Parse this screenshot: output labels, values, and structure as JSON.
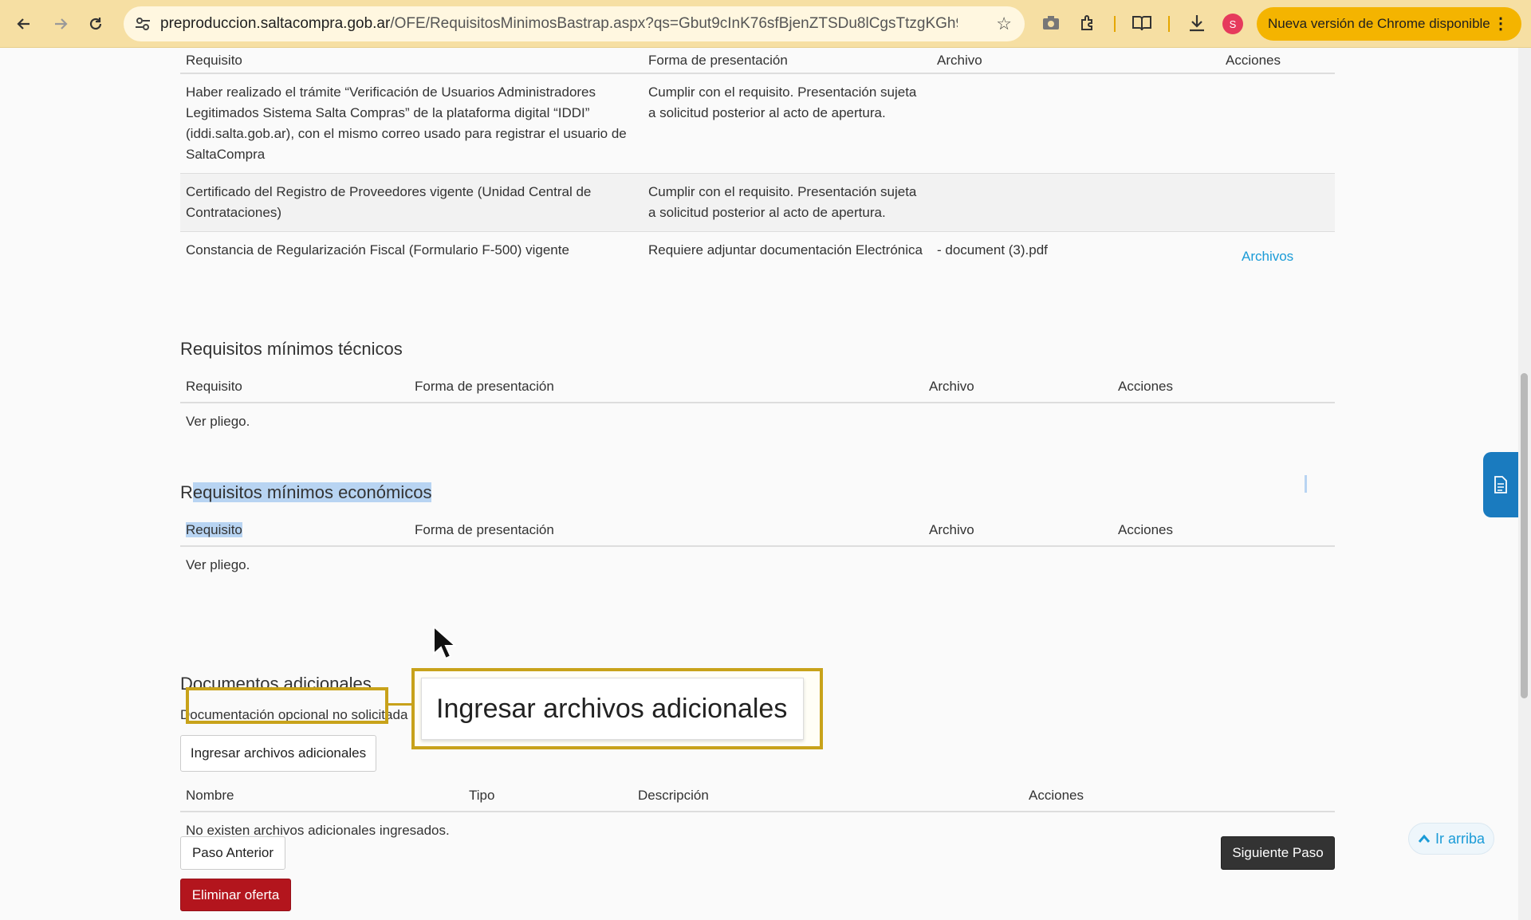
{
  "browser": {
    "url_domain": "preproduccion.saltacompra.gob.ar",
    "url_path": "/OFE/RequisitosMinimosBastrap.aspx?qs=Gbut9cInK76sfBjenZTSDu8lCgsTtzgKGh9Dt...",
    "update_label": "Nueva versión de Chrome disponible",
    "avatar_letter": "S"
  },
  "admin_table": {
    "headers": [
      "Requisito",
      "Forma de presentación",
      "Archivo",
      "Acciones"
    ],
    "rows": [
      {
        "requisito": "Haber realizado el trámite “Verificación de Usuarios Administradores Legitimados Sistema Salta Compras” de la plataforma digital “IDDI” (iddi.salta.gob.ar), con el mismo correo usado para registrar el usuario de SaltaCompra",
        "forma": "Cumplir con el requisito. Presentación sujeta a solicitud posterior al acto de apertura.",
        "archivo": "",
        "acciones": ""
      },
      {
        "requisito": "Certificado del Registro de Proveedores vigente (Unidad Central de Contrataciones)",
        "forma": "Cumplir con el requisito. Presentación sujeta a solicitud posterior al acto de apertura.",
        "archivo": "",
        "acciones": ""
      },
      {
        "requisito": "Constancia de Regularización Fiscal (Formulario F-500) vigente",
        "forma": "Requiere adjuntar documentación Electrónica",
        "archivo": "- document (3).pdf",
        "acciones": "Archivos"
      }
    ]
  },
  "tecnicos": {
    "title": "Requisitos mínimos técnicos",
    "headers": [
      "Requisito",
      "Forma de presentación",
      "Archivo",
      "Acciones"
    ],
    "empty_text": "Ver pliego."
  },
  "economicos": {
    "title_first": "R",
    "title_rest": "equisitos mínimos económicos",
    "headers": [
      "Requisito",
      "Forma de presentación",
      "Archivo",
      "Acciones"
    ],
    "empty_text": "Ver pliego."
  },
  "adicionales": {
    "title": "Documentos adicionales",
    "subtitle": "Documentación opcional no solicitada en pliego.",
    "add_button": "Ingresar archivos adicionales",
    "headers": [
      "Nombre",
      "Tipo",
      "Descripción",
      "Acciones"
    ],
    "empty_text": "No existen archivos adicionales ingresados."
  },
  "footer": {
    "prev_button": "Paso Anterior",
    "next_button": "Siguiente Paso",
    "delete_button": "Eliminar oferta",
    "top_button": "Ir arriba"
  },
  "callout": {
    "text": "Ingresar archivos adicionales"
  },
  "colors": {
    "toolbar": "#f6dfa3",
    "update_pill": "#f4b400",
    "link": "#1a9bd7",
    "danger": "#b3151d",
    "callout_border": "#c8a21a"
  }
}
